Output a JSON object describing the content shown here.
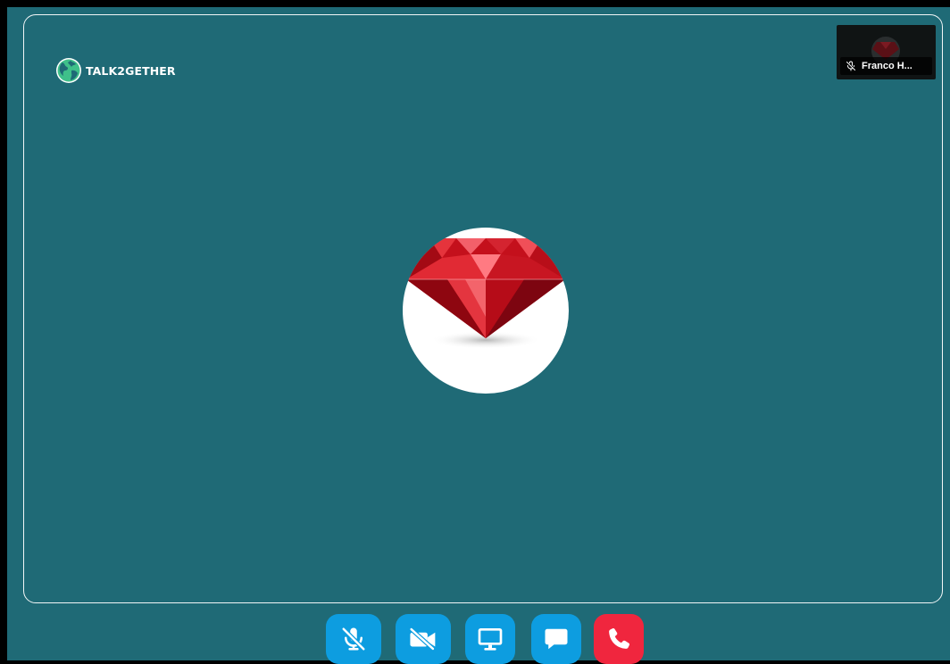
{
  "brand": {
    "name": "TALK2GETHER",
    "icon": "globe-logo-icon"
  },
  "remote_participant": {
    "avatar": "red-diamond-avatar"
  },
  "self_view": {
    "name": "Franco H...",
    "mic_status_icon": "mic-muted-icon"
  },
  "controls": [
    {
      "name": "mute-mic-button",
      "icon": "mic-muted-icon"
    },
    {
      "name": "toggle-camera-button",
      "icon": "camera-off-icon"
    },
    {
      "name": "share-screen-button",
      "icon": "monitor-icon"
    },
    {
      "name": "chat-button",
      "icon": "chat-bubble-icon"
    },
    {
      "name": "end-call-button",
      "icon": "phone-icon"
    }
  ],
  "colors": {
    "stage_background": "#1f6a76",
    "control_button": "#0d9de0",
    "end_call_button": "#f0263e"
  }
}
